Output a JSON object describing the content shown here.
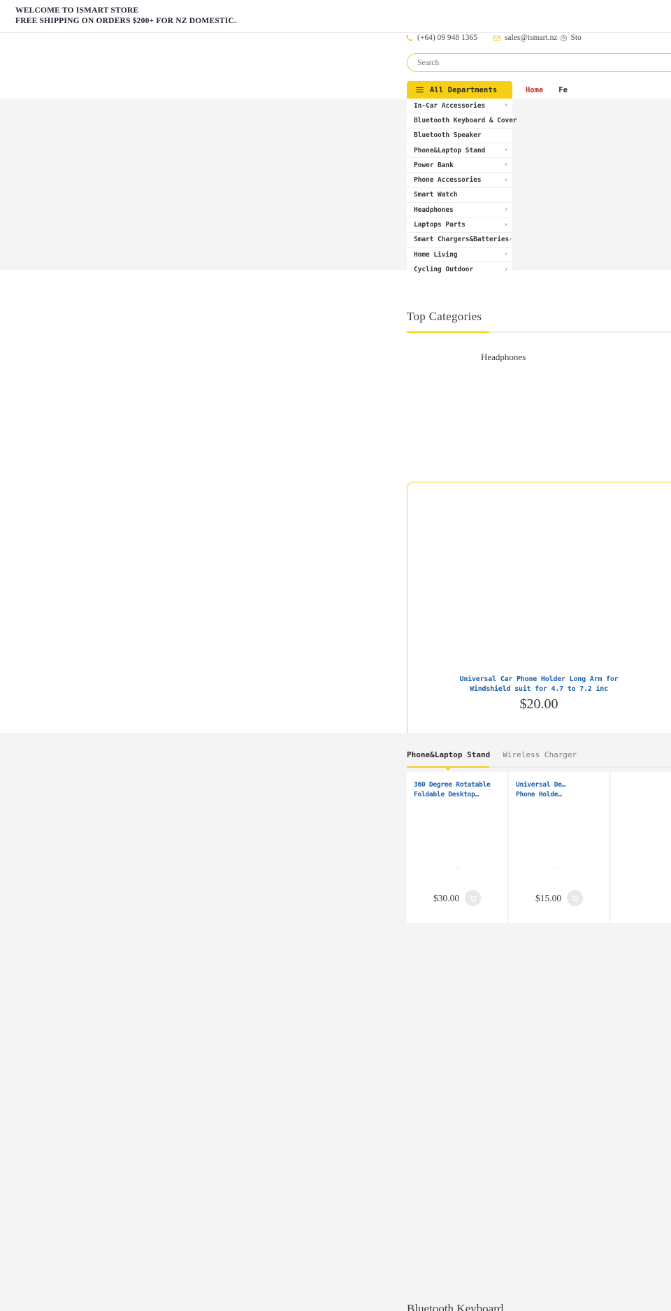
{
  "announcement": {
    "line1": "WELCOME TO ISMART STORE",
    "line2": "FREE SHIPPING ON ORDERS $200+ FOR NZ DOMESTIC."
  },
  "contact": {
    "phone": "(+64) 09 948 1365",
    "email": "sales@ismart.nz",
    "store_locator": "Sto"
  },
  "search": {
    "placeholder": "Search",
    "value": ""
  },
  "departments": {
    "button_label": "All Departments",
    "items": [
      {
        "label": "In-Car Accessories",
        "chevron": "›"
      },
      {
        "label": "Bluetooth Keyboard & Cover",
        "chevron": ""
      },
      {
        "label": "Bluetooth Speaker",
        "chevron": ""
      },
      {
        "label": "Phone&Laptop Stand",
        "chevron": "›"
      },
      {
        "label": "Power Bank",
        "chevron": "›"
      },
      {
        "label": "Phone Accessories",
        "chevron": "›"
      },
      {
        "label": "Smart Watch",
        "chevron": ""
      },
      {
        "label": "Headphones",
        "chevron": "›"
      },
      {
        "label": "Laptops Parts",
        "chevron": "›"
      },
      {
        "label": "Smart Chargers&Batteries",
        "chevron": "›"
      },
      {
        "label": "Home Living",
        "chevron": "›"
      },
      {
        "label": "Cycling Outdoor",
        "chevron": "›"
      }
    ]
  },
  "topnav": {
    "items": [
      {
        "label": "Home",
        "active": true
      },
      {
        "label": "Fe",
        "active": false
      }
    ]
  },
  "top_categories": {
    "title": "Top Categories",
    "visible_category": "Headphones"
  },
  "featured_product": {
    "title_line1": "Universal Car Phone Holder Long Arm for",
    "title_line2": "Windshield suit for 4.7 to 7.2 inc",
    "price": "$20.00"
  },
  "product_tabs": {
    "tabs": [
      {
        "label": "Phone&Laptop Stand",
        "active": true
      },
      {
        "label": "Wireless Charger",
        "active": false
      }
    ]
  },
  "products": [
    {
      "title_line1": "360 Degree Rotatable",
      "title_line2": "Foldable Desktop… Tablet",
      "dots": "…",
      "price": "$30.00",
      "cart_icon": "cart-icon"
    },
    {
      "title_line1": "Universal De…",
      "title_line2": "Phone Holde…",
      "dots": "…",
      "price": "$15.00",
      "cart_icon": "cart-icon"
    },
    {
      "title_line1": "",
      "title_line2": "",
      "dots": "",
      "price": "",
      "cart_icon": "cart-icon"
    }
  ],
  "bottom_section": {
    "heading": "Bluetooth Keyboard"
  },
  "colors": {
    "brand_yellow": "#f5cf16",
    "link_blue": "#1a5fa8",
    "active_nav_red": "#c9252d",
    "page_grey": "#f4f4f4"
  }
}
